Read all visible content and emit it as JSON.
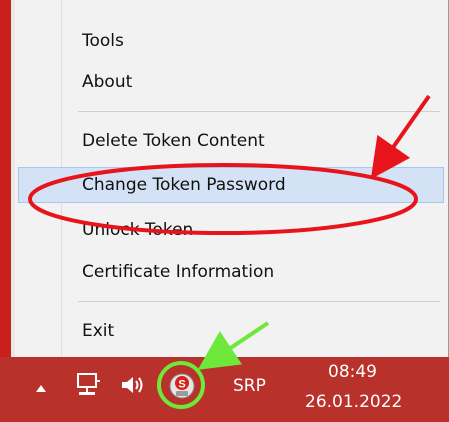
{
  "menu": {
    "items": [
      {
        "label": "Tools"
      },
      {
        "label": "About"
      },
      {
        "label": "Delete Token Content"
      },
      {
        "label": "Change Token Password"
      },
      {
        "label": "Unlock Token"
      },
      {
        "label": "Certificate Information"
      },
      {
        "label": "Exit"
      }
    ],
    "selected_label": "Change Token Password"
  },
  "taskbar": {
    "language": "SRP",
    "time": "08:49",
    "date": "26.01.2022"
  },
  "icons": {
    "show_hidden": "chevron-up-icon",
    "network": "network-icon",
    "volume": "speaker-icon",
    "tray_app": "token-app-icon"
  },
  "colors": {
    "taskbar": "#b8312a",
    "selection": "#d3e3f5",
    "annotation_red": "#e8141c",
    "annotation_green": "#6ee83a"
  }
}
